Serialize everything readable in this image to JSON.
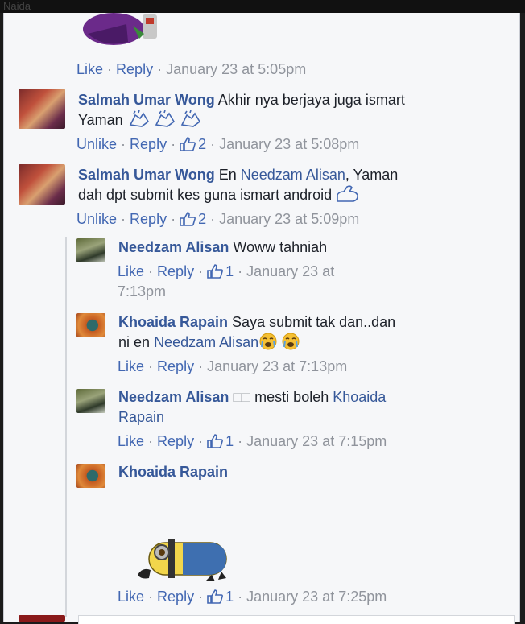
{
  "window": {
    "partial_title": "Naida"
  },
  "comments": [
    {
      "actions": {
        "like": "Like",
        "reply": "Reply",
        "timestamp": "January 23 at 5:05pm"
      }
    },
    {
      "author": "Salmah Umar Wong",
      "text_line1": "Akhir nya berjaya juga ismart",
      "text_line2": "Yaman",
      "emoji": "clapping-hands x3",
      "actions": {
        "like": "Unlike",
        "reply": "Reply",
        "likes": "2",
        "timestamp": "January 23 at 5:08pm"
      }
    },
    {
      "author": "Salmah Umar Wong",
      "text_prefix": "En",
      "mention": "Needzam Alisan",
      "text_line1_suffix": ", Yaman",
      "text_line2": "dah dpt submit kes guna ismart android",
      "emoji": "flexed-biceps",
      "actions": {
        "like": "Unlike",
        "reply": "Reply",
        "likes": "2",
        "timestamp": "January 23 at 5:09pm"
      }
    }
  ],
  "replies": [
    {
      "author": "Needzam Alisan",
      "text": "Woww tahniah",
      "actions": {
        "like": "Like",
        "reply": "Reply",
        "likes": "1",
        "timestamp_line1": "January 23 at",
        "timestamp_line2": "7:13pm"
      }
    },
    {
      "author": "Khoaida Rapain",
      "text_line1": "Saya submit tak dan..dan",
      "text_line2_prefix": "ni en",
      "mention": "Needzam Alisan",
      "emoji": "crying-face x2",
      "actions": {
        "like": "Like",
        "reply": "Reply",
        "timestamp": "January 23 at 7:13pm"
      }
    },
    {
      "author": "Needzam Alisan",
      "missing_glyphs": "□□",
      "text": "mesti boleh",
      "mention_line1": "Khoaida",
      "mention_line2": "Rapain",
      "actions": {
        "like": "Like",
        "reply": "Reply",
        "likes": "1",
        "timestamp": "January 23 at 7:15pm"
      }
    },
    {
      "author": "Khoaida Rapain",
      "sticker": "minion-lying-down",
      "actions": {
        "like": "Like",
        "reply": "Reply",
        "likes": "1",
        "timestamp": "January 23 at 7:25pm"
      }
    }
  ],
  "colors": {
    "name": "#365899",
    "link": "#4267b2",
    "meta": "#90949c",
    "text": "#1d2129",
    "background": "#f6f7f9"
  }
}
